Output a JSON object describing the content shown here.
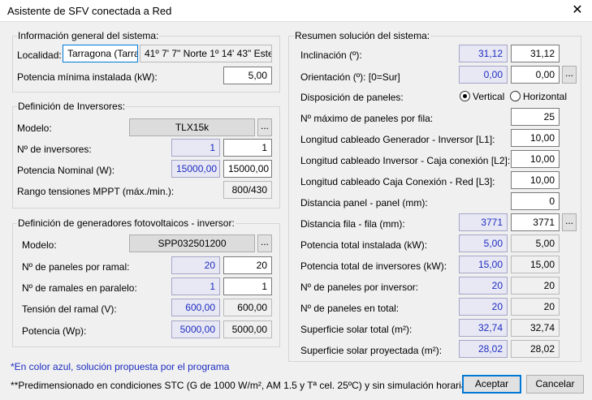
{
  "window": {
    "title": "Asistente de SFV conectada a Red"
  },
  "info_general": {
    "group_title": "Información general del sistema:",
    "localidad_label": "Localidad:",
    "localidad_value": "Tarragona (Tarrag",
    "coordenadas": "41º 7' 7\" Norte 1º 14' 43\" Este",
    "potencia_label": "Potencia mínima instalada (kW):",
    "potencia_value": "5,00"
  },
  "inversores": {
    "group_title": "Definición de Inversores:",
    "modelo_label": "Modelo:",
    "modelo_value": "TLX15k",
    "dots": "...",
    "num_label": "Nº de inversores:",
    "num_sugerido": "1",
    "num_value": "1",
    "potencia_label": "Potencia Nominal (W):",
    "potencia_sugerido": "15000,00",
    "potencia_value": "15000,00",
    "rango_label": "Rango tensiones MPPT (máx./min.):",
    "rango_value": "800/430"
  },
  "generadores": {
    "group_title": "Definición de generadores fotovoltaicos - inversor:",
    "modelo_label": "Modelo:",
    "modelo_value": "SPP032501200",
    "dots": "...",
    "paneles_ramal_label": "Nº de paneles por ramal:",
    "paneles_ramal_sugerido": "20",
    "paneles_ramal_value": "20",
    "ramales_label": "Nº de ramales en paralelo:",
    "ramales_sugerido": "1",
    "ramales_value": "1",
    "tension_label": "Tensión del ramal (V):",
    "tension_sugerido": "600,00",
    "tension_value": "600,00",
    "potencia_label": "Potencia (Wp):",
    "potencia_sugerido": "5000,00",
    "potencia_value": "5000,00"
  },
  "resumen": {
    "group_title": "Resumen solución del sistema:",
    "inclinacion_label": "Inclinación (º):",
    "inclinacion_sugerido": "31,12",
    "inclinacion_value": "31,12",
    "orientacion_label": "Orientación (º): [0=Sur]",
    "orientacion_sugerido": "0,00",
    "orientacion_value": "0,00",
    "dots": "...",
    "disposicion_label": "Disposición de paneles:",
    "vertical_label": "Vertical",
    "horizontal_label": "Horizontal",
    "max_paneles_label": "Nº máximo de paneles por fila:",
    "max_paneles_value": "25",
    "l1_label": "Longitud cableado Generador - Inversor [L1]:",
    "l1_value": "10,00",
    "l2_label": "Longitud cableado Inversor - Caja conexión [L2]:",
    "l2_value": "10,00",
    "l3_label": "Longitud cableado Caja Conexión - Red [L3]:",
    "l3_value": "10,00",
    "dist_panel_label": "Distancia panel - panel (mm):",
    "dist_panel_value": "0",
    "dist_fila_label": "Distancia fila - fila (mm):",
    "dist_fila_sugerido": "3771",
    "dist_fila_value": "3771",
    "pot_instalada_label": "Potencia total instalada (kW):",
    "pot_instalada_sugerido": "5,00",
    "pot_instalada_value": "5,00",
    "pot_inversores_label": "Potencia total de inversores (kW):",
    "pot_inversores_sugerido": "15,00",
    "pot_inversores_value": "15,00",
    "paneles_inversor_label": "Nº de paneles por inversor:",
    "paneles_inversor_sugerido": "20",
    "paneles_inversor_value": "20",
    "paneles_total_label": "Nº de paneles en total:",
    "paneles_total_sugerido": "20",
    "paneles_total_value": "20",
    "superficie_label": "Superficie solar total (m²):",
    "superficie_sugerido": "32,74",
    "superficie_value": "32,74",
    "proyectada_label": "Superficie solar proyectada (m²):",
    "proyectada_sugerido": "28,02",
    "proyectada_value": "28,02"
  },
  "notes": {
    "blue_note": "*En color azul, solución propuesta por el programa",
    "stc_note": "**Predimensionado en condiciones STC (G de 1000 W/m², AM 1.5 y Tª cel. 25ºC) y sin simulación horaria"
  },
  "buttons": {
    "accept": "Aceptar",
    "cancel": "Cancelar"
  },
  "colors": {
    "suggested_text": "#1c2cc0",
    "default_button_border": "#0078d7"
  }
}
